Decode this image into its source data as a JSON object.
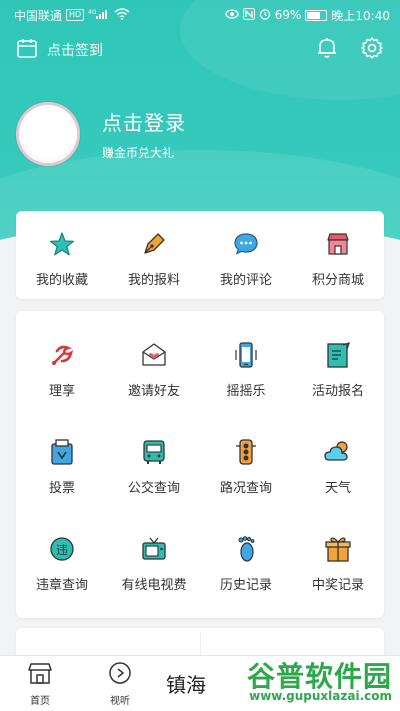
{
  "status_bar": {
    "carrier": "中国联通",
    "hd": "HD",
    "signal": "4G",
    "battery_percent": "69%",
    "battery_level": 0.69,
    "time": "晚上10:40"
  },
  "toolbar": {
    "sign_in_label": "点击签到",
    "icons": [
      "calendar-icon",
      "bell-icon",
      "gear-icon"
    ]
  },
  "profile": {
    "title": "点击登录",
    "subtitle": "赚金币兑大礼"
  },
  "quick_actions": [
    {
      "label": "我的收藏",
      "icon": "star-icon",
      "color": "#2cc0b3"
    },
    {
      "label": "我的报料",
      "icon": "pen-icon",
      "color": "#f2a23a"
    },
    {
      "label": "我的评论",
      "icon": "chat-icon",
      "color": "#3fa7e6"
    },
    {
      "label": "积分商城",
      "icon": "store-icon",
      "color": "#e75b6e"
    }
  ],
  "services": [
    {
      "label": "理享",
      "icon": "party-icon"
    },
    {
      "label": "邀请好友",
      "icon": "heart-envelope-icon"
    },
    {
      "label": "摇摇乐",
      "icon": "phone-icon"
    },
    {
      "label": "活动报名",
      "icon": "form-icon"
    },
    {
      "label": "投票",
      "icon": "vote-icon"
    },
    {
      "label": "公交查询",
      "icon": "bus-icon"
    },
    {
      "label": "路况查询",
      "icon": "traffic-light-icon"
    },
    {
      "label": "天气",
      "icon": "weather-icon"
    },
    {
      "label": "违章查询",
      "icon": "violation-icon"
    },
    {
      "label": "有线电视费",
      "icon": "tv-icon"
    },
    {
      "label": "历史记录",
      "icon": "footprint-icon"
    },
    {
      "label": "中奖记录",
      "icon": "gift-icon"
    }
  ],
  "bottom_nav": {
    "home_label": "首页",
    "listen_label": "视听",
    "center_text": "镇海"
  },
  "watermark": {
    "title": "谷普软件园",
    "url": "www.gupuxlazai.com"
  },
  "colors": {
    "brand_teal": "#33c8ba",
    "watermark_green": "#2da84b"
  }
}
